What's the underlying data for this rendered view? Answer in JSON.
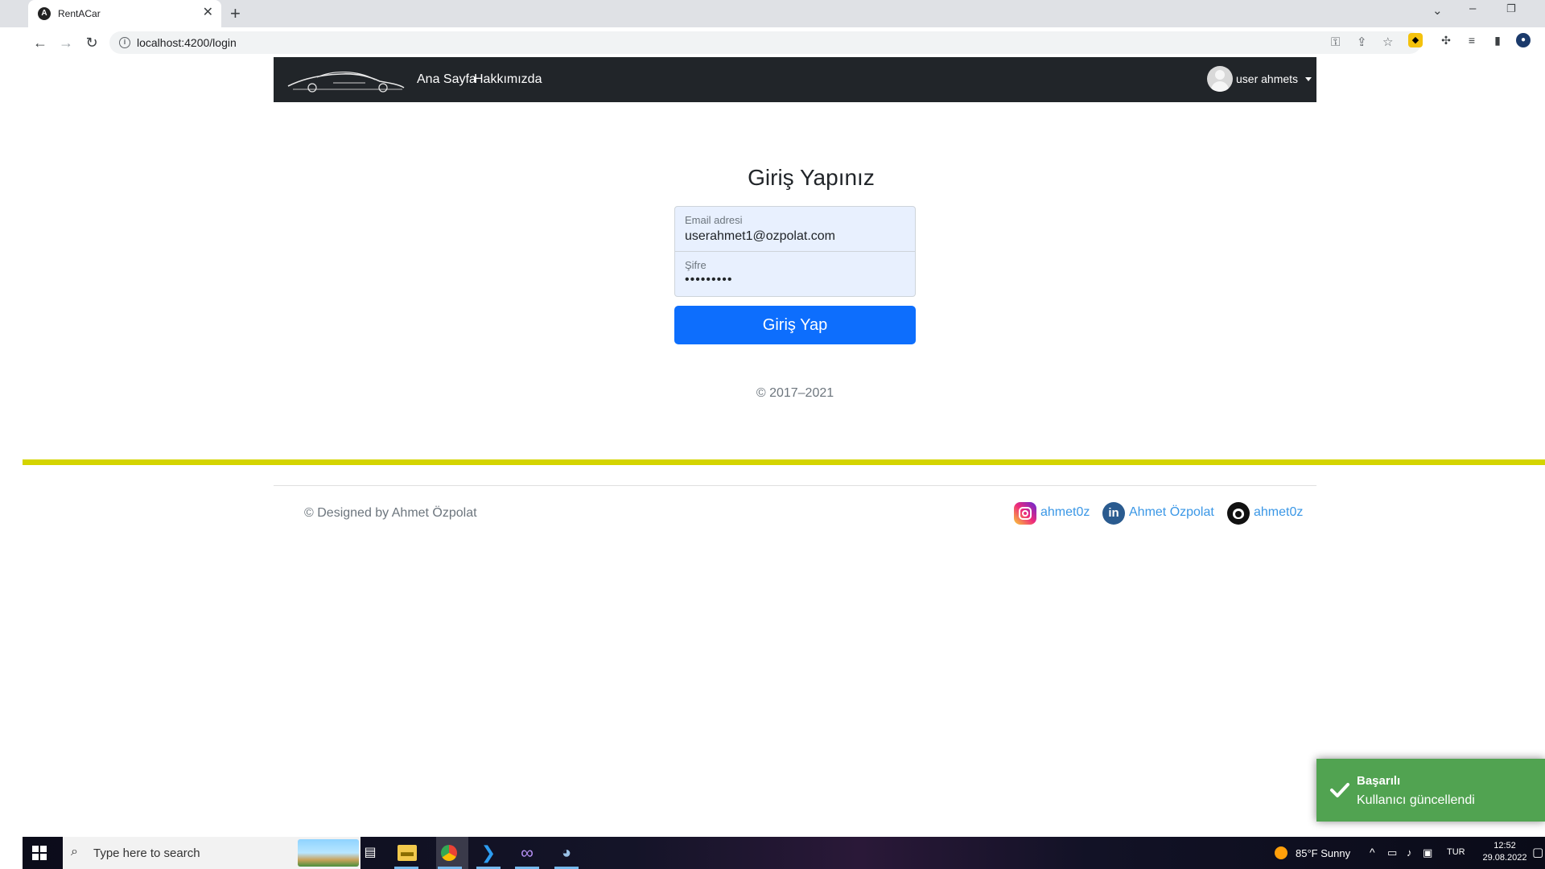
{
  "browser": {
    "tab_title": "RentACar",
    "url": "localhost:4200/login",
    "new_tab": "+",
    "tab_close": "✕"
  },
  "navbar": {
    "links": [
      "Ana Sayfa",
      "Hakkımızda"
    ],
    "user_name": "user ahmets"
  },
  "login": {
    "title": "Giriş Yapınız",
    "email_label": "Email adresi",
    "email_value": "userahmet1@ozpolat.com",
    "password_label": "Şifre",
    "password_value": "•••••••••",
    "submit_label": "Giriş Yap",
    "copyright": "© 2017–2021"
  },
  "footer": {
    "designed_by": "© Designed by Ahmet Özpolat",
    "social": [
      {
        "icon": "instagram-icon",
        "label": "ahmet0z"
      },
      {
        "icon": "linkedin-icon",
        "label": "Ahmet Özpolat"
      },
      {
        "icon": "github-icon",
        "label": "ahmet0z"
      }
    ]
  },
  "toast": {
    "title": "Başarılı",
    "message": "Kullanıcı güncellendi",
    "color": "#51a351"
  },
  "taskbar": {
    "search_placeholder": "Type here to search",
    "weather": "85°F  Sunny",
    "language": "TUR",
    "time": "12:52",
    "date": "29.08.2022"
  },
  "colors": {
    "navbar_bg": "#212529",
    "primary_button": "#0d6efd",
    "divider_accent": "#d4d400",
    "link": "#3a97e6"
  }
}
